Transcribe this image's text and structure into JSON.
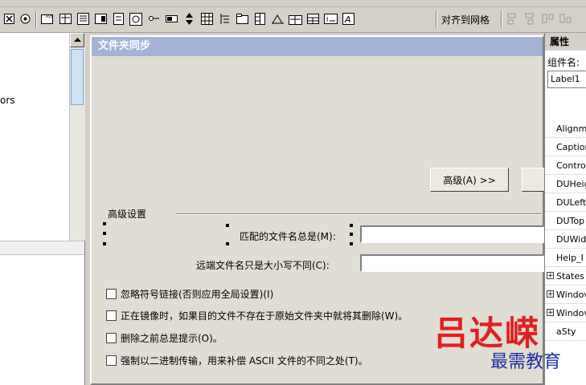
{
  "toolbar": {
    "align_to_grid_label": "对齐到网格",
    "icons": [
      "close-box-icon",
      "radio-icon",
      "text-label-icon",
      "frame-icon",
      "list-icon",
      "combo-icon",
      "pagecontrol-icon",
      "image-icon",
      "tree-icon",
      "slider-icon",
      "progress-icon",
      "spinner-icon",
      "grid-icon",
      "hierarchy-icon",
      "window-icon",
      "column-icon",
      "tool-icon",
      "statusbar-icon",
      "table-icon",
      "caption-icon",
      "a-icon"
    ]
  },
  "left_panel": {
    "partial_text": "ors"
  },
  "form": {
    "title": "文件夹同步",
    "advanced_button": "高级(A) >>",
    "group_label": "高级设置",
    "match_label": "匹配的文件名总是(M):",
    "remote_label": "远端文件名只是大小写不同(C):",
    "match_value": "",
    "remote_value": "",
    "checkboxes": [
      {
        "label": "忽略符号链接(否则应用全局设置)(I)",
        "checked": false
      },
      {
        "label": "正在镜像时，如果目的文件不存在于原始文件夹中就将其删除(W)。",
        "checked": false
      },
      {
        "label": "删除之前总是提示(O)。",
        "checked": false
      },
      {
        "label": "强制以二进制传输，用来补偿 ASCII 文件的不同之处(T)。",
        "checked": false
      }
    ]
  },
  "properties": {
    "title": "属性",
    "component_name_label": "组件名:",
    "component_name_value": "Label1",
    "rows": [
      {
        "name": "Alignme",
        "expandable": false
      },
      {
        "name": "Caption",
        "expandable": false
      },
      {
        "name": "Contro",
        "expandable": false
      },
      {
        "name": "DUHeig",
        "expandable": false
      },
      {
        "name": "DULeft",
        "expandable": false
      },
      {
        "name": "DUTop",
        "expandable": false
      },
      {
        "name": "DUWid",
        "expandable": false
      },
      {
        "name": "Help_I",
        "expandable": false
      },
      {
        "name": "States",
        "expandable": true
      },
      {
        "name": "Windov",
        "expandable": true
      },
      {
        "name": "Windov",
        "expandable": true
      },
      {
        "name": "aSty",
        "expandable": false
      }
    ]
  },
  "watermark": {
    "line1": "吕达嵘",
    "line2": "最需教育"
  }
}
